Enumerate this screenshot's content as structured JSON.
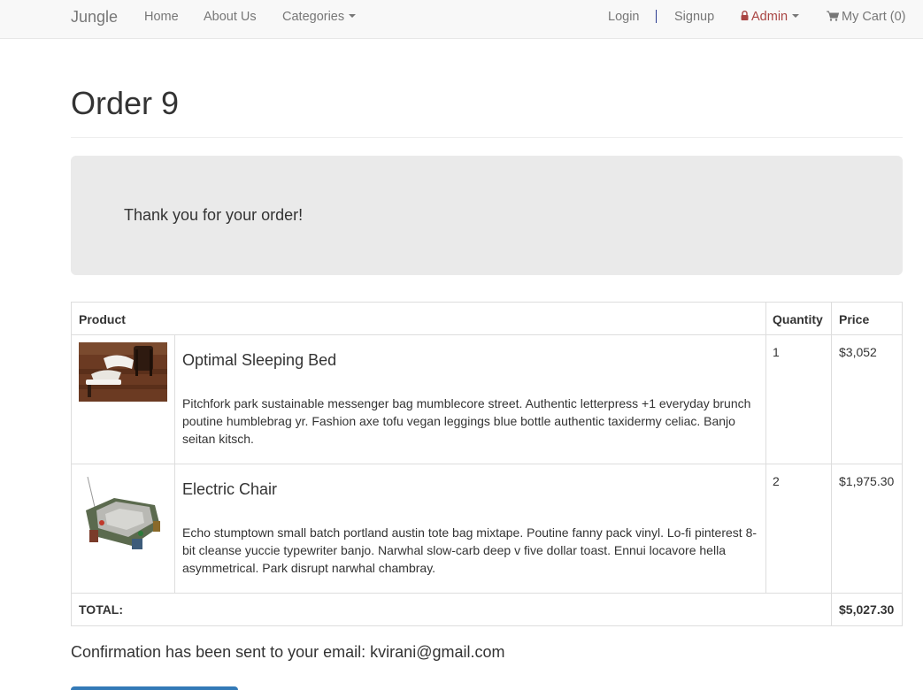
{
  "nav": {
    "brand": "Jungle",
    "home": "Home",
    "about": "About Us",
    "categories": "Categories",
    "login": "Login",
    "signup": "Signup",
    "admin": "Admin",
    "cart": "My Cart (0)"
  },
  "page": {
    "title": "Order 9",
    "thank_you": "Thank you for your order!",
    "confirmation": "Confirmation has been sent to your email: kvirani@gmail.com"
  },
  "table": {
    "headers": {
      "product": "Product",
      "quantity": "Quantity",
      "price": "Price"
    },
    "rows": [
      {
        "name": "Optimal Sleeping Bed",
        "description": "Pitchfork park sustainable messenger bag mumblecore street. Authentic letterpress +1 everyday brunch poutine humblebrag yr. Fashion axe tofu vegan leggings blue bottle authentic taxidermy celiac. Banjo seitan kitsch.",
        "quantity": "1",
        "price": "$3,052"
      },
      {
        "name": "Electric Chair",
        "description": "Echo stumptown small batch portland austin tote bag mixtape. Poutine fanny pack vinyl. Lo-fi pinterest 8-bit cleanse yuccie typewriter banjo. Narwhal slow-carb deep v five dollar toast. Ennui locavore hella asymmetrical. Park disrupt narwhal chambray.",
        "quantity": "2",
        "price": "$1,975.30"
      }
    ],
    "total_label": "TOTAL:",
    "total_value": "$5,027.30"
  },
  "colors": {
    "navbar_bg": "#f8f8f8",
    "admin_red": "#a94442",
    "jumbotron_bg": "#eaeaea",
    "primary_button": "#337ab7"
  }
}
